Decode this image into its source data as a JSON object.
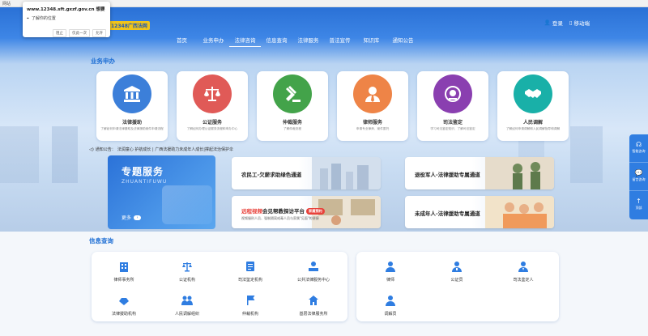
{
  "browser": {
    "tab": "网站"
  },
  "popup": {
    "url": "www.12348.sft.gxzf.gov.cn 想要",
    "permission": "了解你的位置",
    "buttons": [
      "阻止",
      "仅此一次",
      "允许"
    ]
  },
  "header": {
    "logo": "桂网",
    "logo_sub": "12348广西法网",
    "login": "登录",
    "mobile": "移动端",
    "nav": [
      "首页",
      "业务申办",
      "法律咨询",
      "信息查询",
      "法律服务",
      "普法宣传",
      "知识库",
      "通知公告"
    ],
    "active_nav_index": 2
  },
  "business": {
    "title": "业务申办",
    "cards": [
      {
        "name": "法律援助",
        "desc": "了解如何申请法律援助及法律援助案件申请流程",
        "color": "#3c7fd9"
      },
      {
        "name": "公证服务",
        "desc": "了解如何办理公证服务流程和申办中心",
        "color": "#e05a57"
      },
      {
        "name": "仲裁服务",
        "desc": "了解仲裁流程",
        "color": "#43a34a"
      },
      {
        "name": "律师服务",
        "desc": "申请专业律师、案件委托",
        "color": "#ee8447"
      },
      {
        "name": "司法鉴定",
        "desc": "学习司法鉴定知识、了解司法鉴定",
        "color": "#8a3fb0"
      },
      {
        "name": "人民调解",
        "desc": "了解如何申请调解和人民调解指导和调解",
        "color": "#19b0a8"
      }
    ]
  },
  "notice": {
    "label": "通知公告：",
    "text": "法润童心 护航成长 | 广西法援助力未成年人成长|撑起法治保护伞"
  },
  "topics": {
    "big_title": "专题服务",
    "big_pinyin": "ZHUANTIFUWU",
    "more": "更多",
    "more_icon": "›",
    "items": [
      {
        "label": "农民工-欠薪求助绿色通道"
      },
      {
        "label": "退役军人-法律援助专属通道"
      },
      {
        "label_red": "远程视频",
        "label": "会见帮教探访平台",
        "tag": "家属预约",
        "sub": "视频服刑人员、强制隔离戒毒人员与家属\"见面\"的便捷"
      },
      {
        "label": "未成年人-法律援助专属通道"
      }
    ]
  },
  "side_tools": [
    "智能咨询",
    "留言咨询",
    "顶部"
  ],
  "info": {
    "title": "信息查询",
    "left": [
      "律师事务所",
      "公证机构",
      "司法鉴定机构",
      "公共法律服务中心",
      "法律援助机构",
      "人民调解组织",
      "仲裁机构",
      "基层法律服务所"
    ],
    "right": [
      "律师",
      "公证员",
      "司法鉴定人",
      "调解员"
    ]
  },
  "colors": {
    "primary": "#2f7de1",
    "title": "#1f6fd4"
  }
}
